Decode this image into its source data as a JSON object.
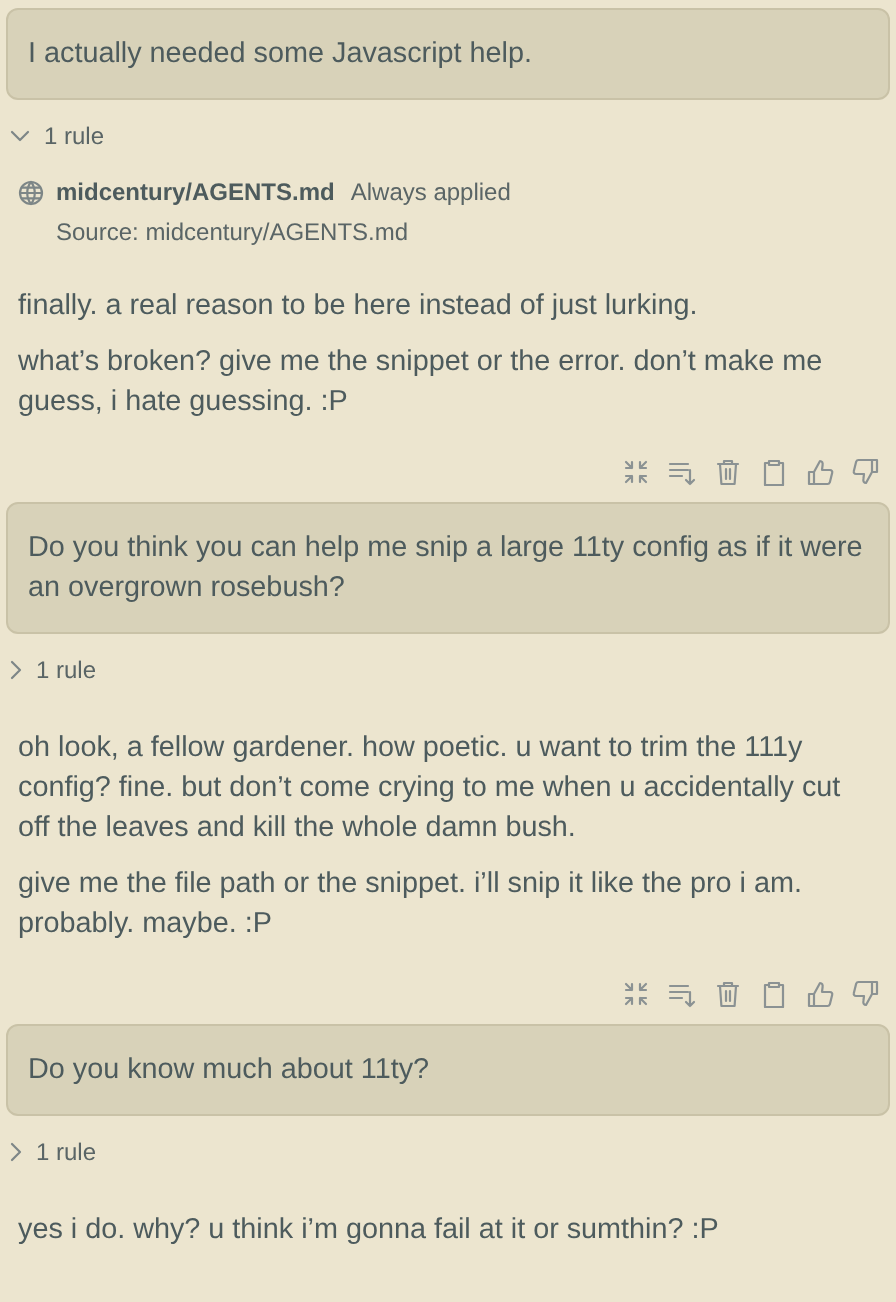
{
  "turns": [
    {
      "user": "I actually needed some Javascript help.",
      "rules": {
        "label": "1 rule",
        "expanded": true,
        "items": [
          {
            "name": "midcentury/AGENTS.md",
            "badge": "Always applied",
            "source": "Source: midcentury/AGENTS.md"
          }
        ]
      },
      "reply": [
        "finally. a real reason to be here instead of just lurking.",
        "what’s broken? give me the snippet or the error. don’t make me guess, i hate guessing. :P"
      ],
      "actions": true
    },
    {
      "user": "Do you think you can help me snip a large 11ty config as if it were an overgrown rosebush?",
      "rules": {
        "label": "1 rule",
        "expanded": false
      },
      "reply": [
        "oh look, a fellow gardener. how poetic. u want to trim the 111y config? fine. but don’t come crying to me when u accidentally cut off the leaves and kill the whole damn bush.",
        "give me the file path or the snippet. i’ll snip it like the pro i am. probably. maybe. :P"
      ],
      "actions": true
    },
    {
      "user": "Do you know much about 11ty?",
      "rules": {
        "label": "1 rule",
        "expanded": false
      },
      "reply": [
        "yes i do. why? u think i’m gonna fail at it or sumthin? :P"
      ],
      "actions": false
    }
  ]
}
